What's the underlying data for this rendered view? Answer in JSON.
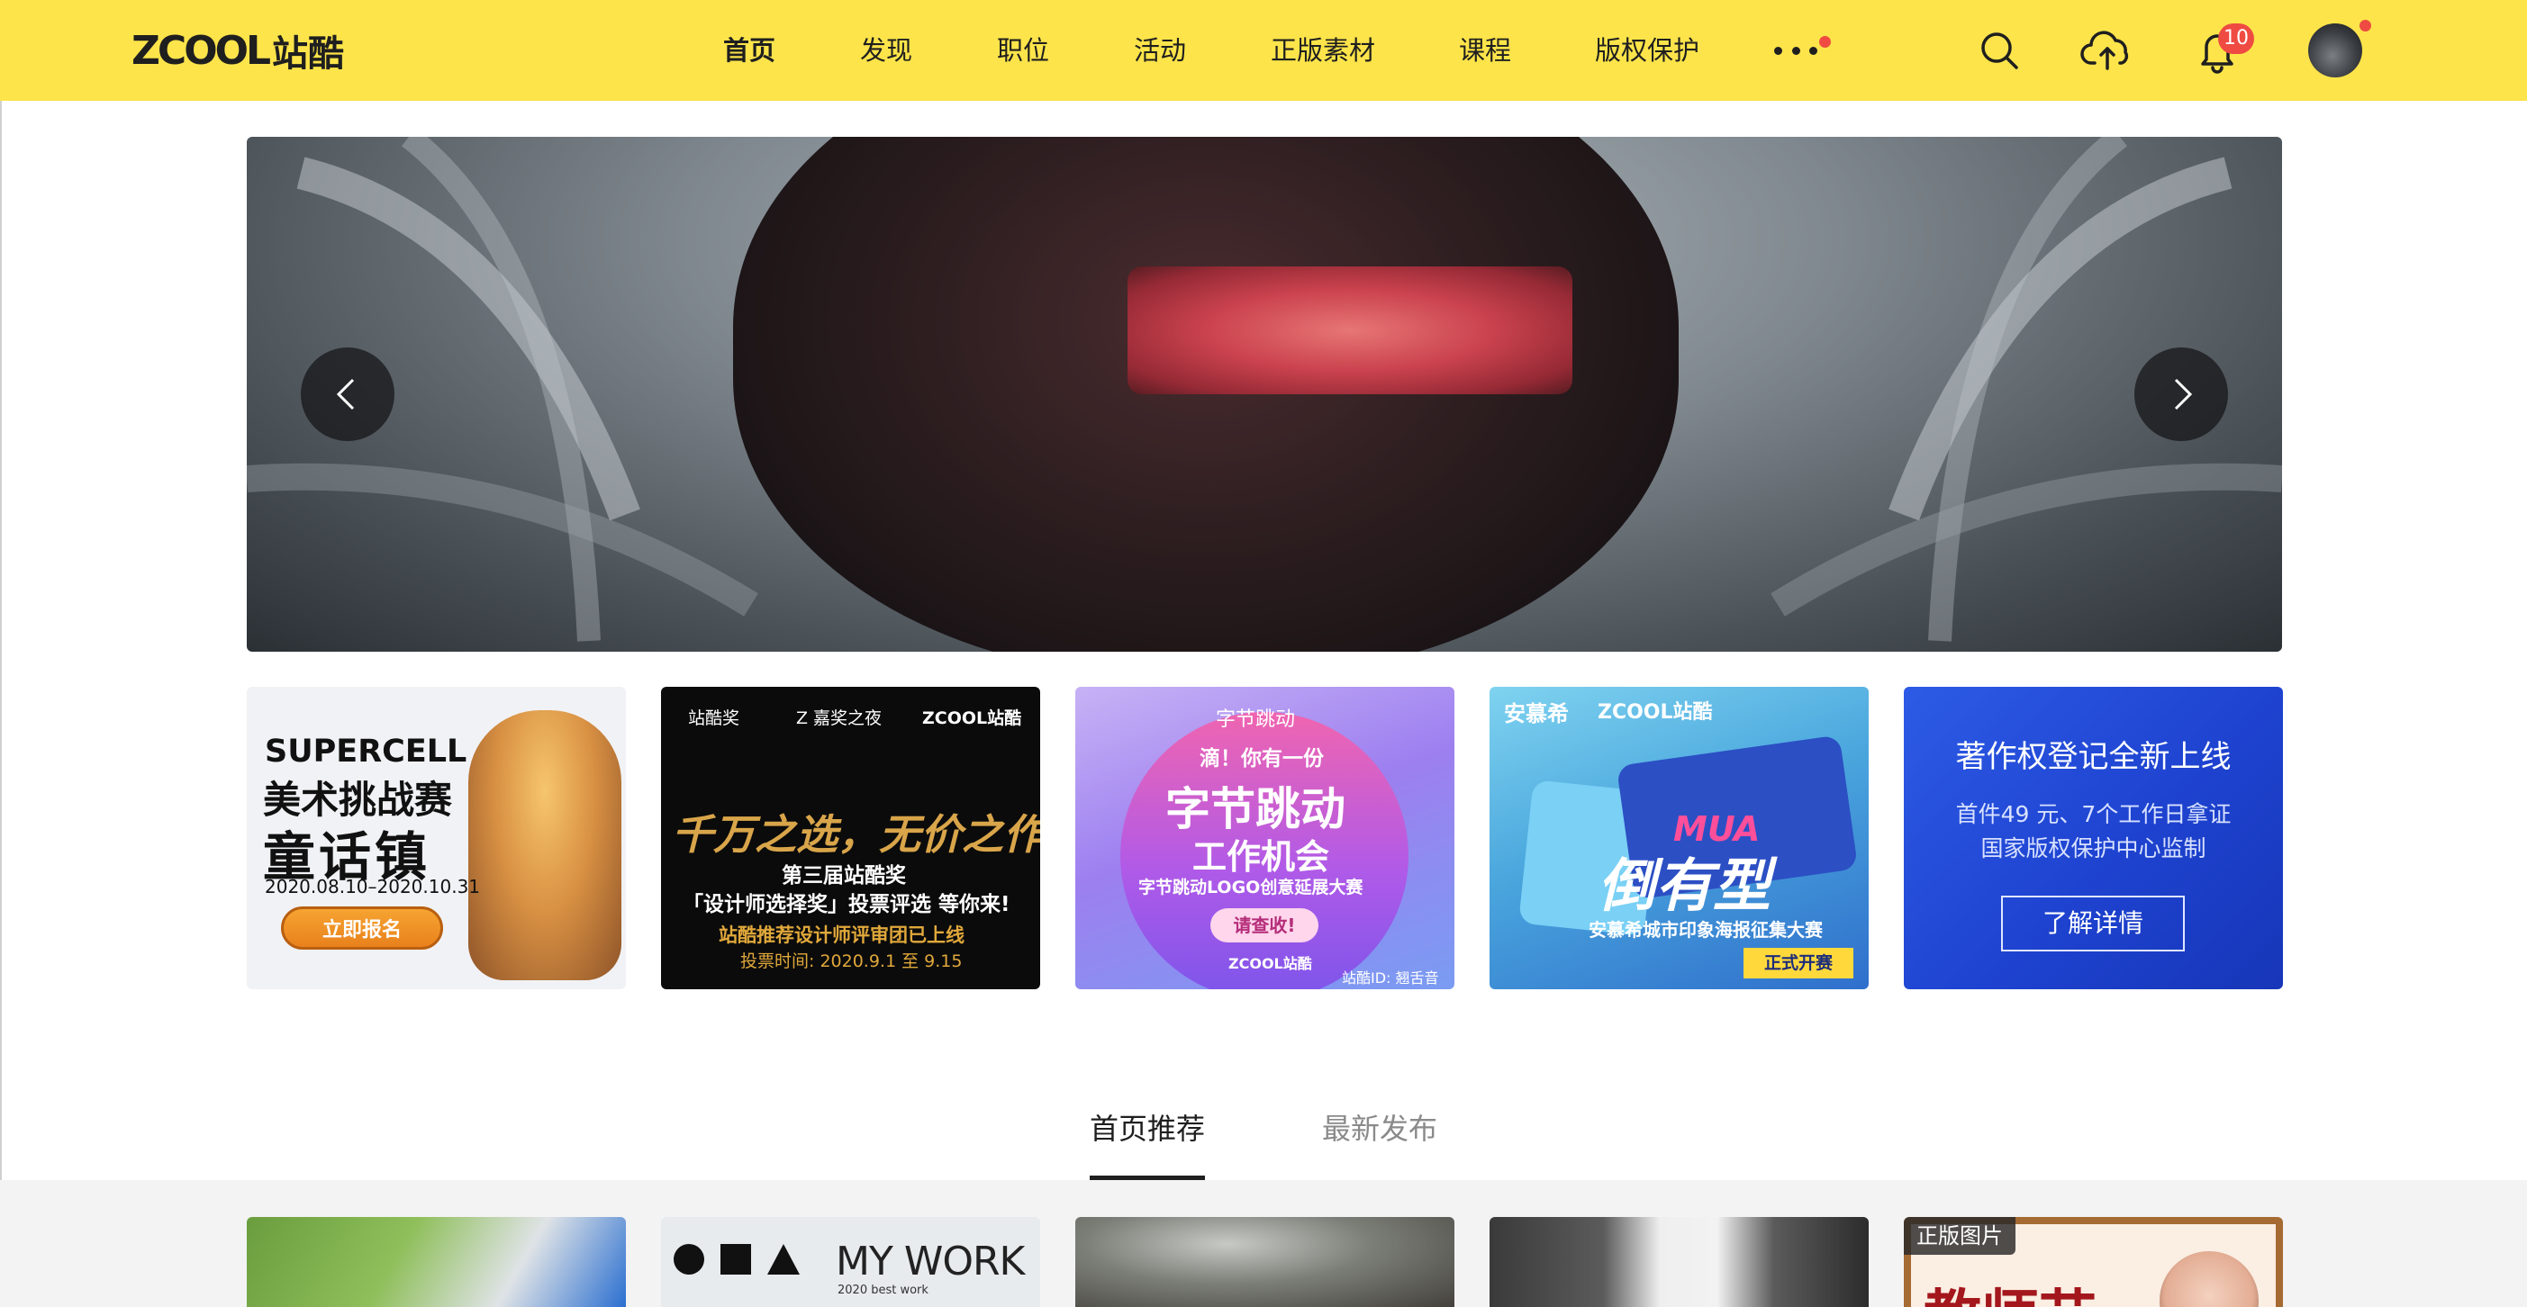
{
  "brand": {
    "logo_latin": "ZCOOL",
    "logo_cjk": "站酷"
  },
  "nav": {
    "items": [
      "首页",
      "发现",
      "职位",
      "活动",
      "正版素材",
      "课程",
      "版权保护"
    ],
    "active_index": 0
  },
  "toolbar": {
    "search_icon": "search-icon",
    "upload_icon": "cloud-upload-icon",
    "bell_icon": "bell-icon",
    "notification_count": "10"
  },
  "colors": {
    "topbar": "#fde44a",
    "badge": "#ef4b43",
    "text": "#1f1f1f"
  },
  "hero": {
    "prev_icon": "chevron-left-icon",
    "next_icon": "chevron-right-icon"
  },
  "promos": [
    {
      "line1": "SUPERCELL",
      "line2": "美术挑战赛",
      "line3": "童话镇",
      "dates": "2020.08.10–2020.10.31",
      "button": "立即报名"
    },
    {
      "hdr1": "站酷奖",
      "hdr2": "Z 嘉奖之夜",
      "hdr3": "ZCOOL站酷",
      "headline": "千万之选，无价之作",
      "line1": "第三届站酷奖",
      "line2": "「设计师选择奖」投票评选 等你来!",
      "line3": "站酷推荐设计师评审团已上线",
      "line4": "投票时间: 2020.9.1 至 9.15"
    },
    {
      "brand": "字节跳动",
      "line1": "滴！你有一份",
      "line2": "字节跳动",
      "line3": "工作机会",
      "line4": "字节跳动LOGO创意延展大赛",
      "button": "请查收!",
      "footer1": "ZCOOL站酷",
      "footer2": "站酷ID: 翘舌音"
    },
    {
      "hdr1": "安慕希",
      "hdr2": "ZCOOL站酷",
      "mua": "MUA",
      "headline": "倒有型",
      "sub": "安慕希城市印象海报征集大赛",
      "tag": "正式开赛"
    },
    {
      "title": "著作权登记全新上线",
      "line1": "首件49 元、7个工作日拿证",
      "line2": "国家版权保护中心监制",
      "button": "了解详情"
    }
  ],
  "feed": {
    "tabs": [
      "首页推荐",
      "最新发布"
    ],
    "active_index": 0
  },
  "thumbs": {
    "t2_title": "MY WORK",
    "t2_sub": "2020 best work",
    "t5_label": "正版图片",
    "t5_title": "教师节"
  }
}
